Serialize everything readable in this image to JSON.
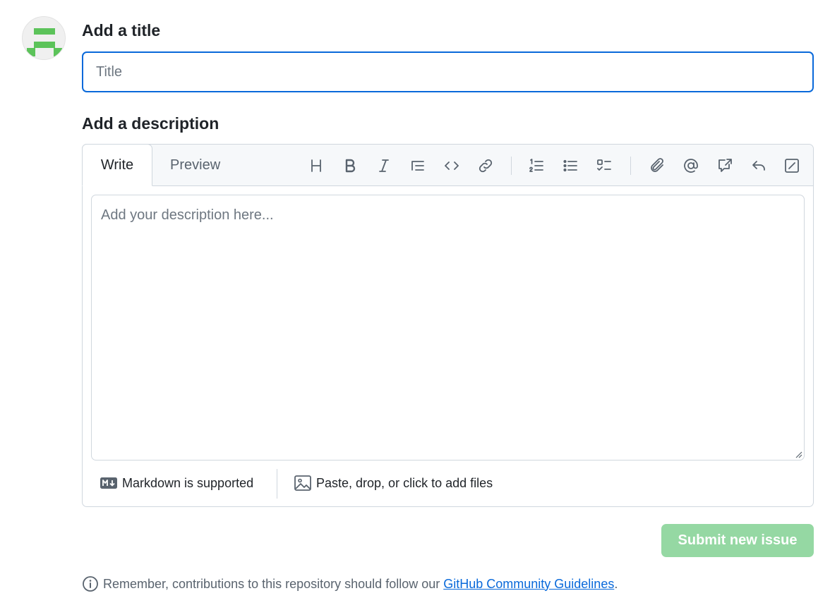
{
  "avatar": {
    "icon": "identicon",
    "color": "#5cc35a"
  },
  "title_section": {
    "heading": "Add a title",
    "input_placeholder": "Title",
    "input_value": ""
  },
  "description_section": {
    "heading": "Add a description",
    "tabs": [
      {
        "label": "Write",
        "active": true
      },
      {
        "label": "Preview",
        "active": false
      }
    ],
    "toolbar": [
      "heading-icon",
      "bold-icon",
      "italic-icon",
      "quote-icon",
      "code-icon",
      "link-icon",
      "ordered-list-icon",
      "unordered-list-icon",
      "task-list-icon",
      "attach-icon",
      "mention-icon",
      "reference-icon",
      "reply-icon",
      "slash-command-icon"
    ],
    "textarea_placeholder": "Add your description here...",
    "footer": {
      "markdown_label": "Markdown is supported",
      "files_label": "Paste, drop, or click to add files"
    }
  },
  "submit_label": "Submit new issue",
  "notice": {
    "text": "Remember, contributions to this repository should follow our",
    "link_text": "GitHub Community Guidelines",
    "trailing": "."
  },
  "colors": {
    "accent": "#0969da",
    "submit_disabled_bg": "#95d8a3",
    "avatar_green": "#5cc35a"
  }
}
